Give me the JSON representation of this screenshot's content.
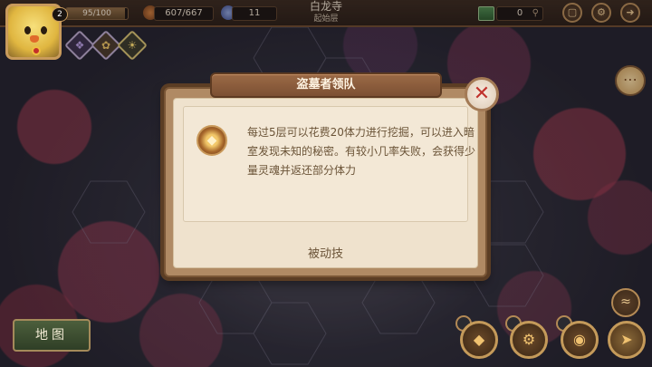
{
  "top_bar": {
    "level": "2",
    "hp_text": "95/100",
    "hp_fraction": 0.95,
    "food_text": "607/667",
    "gem_count": "11",
    "location_name": "白龙寺",
    "floor_name": "起始层",
    "chest_count": "0"
  },
  "dialog": {
    "title": "盗墓者领队",
    "description": "每过5层可以花费20体力进行挖掘，可以进入暗室发现未知的秘密。有较小几率失败，会获得少量灵魂并返还部分体力",
    "skill_type": "被动技",
    "close_symbol": "✕"
  },
  "bottom": {
    "map_label": "地图"
  },
  "icons": {
    "food": "meat-icon",
    "gem": "gem-icon",
    "chest": "chest-icon",
    "search": "search-icon",
    "bag": "bag-icon",
    "settings": "gear-icon",
    "exit": "exit-icon",
    "chat": "chat-icon",
    "skill": "shield-emblem-icon"
  },
  "colors": {
    "accent_red": "#c0332d",
    "frame_brown": "#7a5636",
    "parchment": "#efe2cd"
  }
}
